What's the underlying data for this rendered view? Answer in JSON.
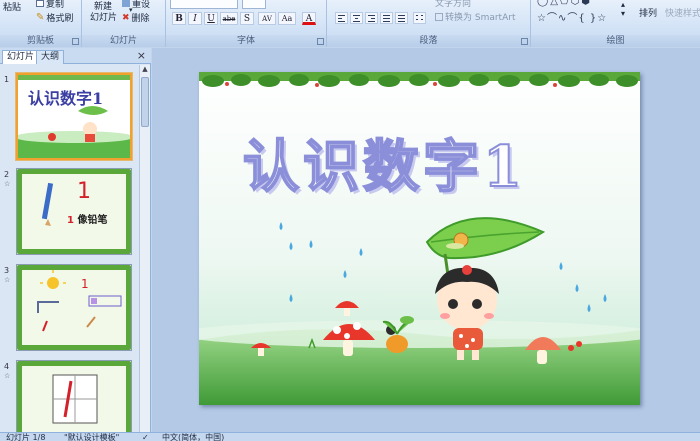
{
  "ribbon": {
    "clipboard": {
      "label": "剪贴板",
      "paste": "粘贴",
      "copy": "复制",
      "format_painter": "格式刷"
    },
    "slides": {
      "label": "幻灯片",
      "new_slide": "新建",
      "new_slide_2": "幻灯片",
      "reset": "重设",
      "delete": "删除"
    },
    "font": {
      "label": "字体",
      "bold": "B",
      "italic": "I",
      "underline": "U",
      "strike": "abe",
      "shadow": "S",
      "spacing": "AV",
      "case": "Aa",
      "color": "A"
    },
    "paragraph": {
      "label": "段落",
      "text_direction": "文字方向",
      "convert_smartart": "转换为 SmartArt"
    },
    "drawing": {
      "label": "绘图",
      "arrange": "排列",
      "quick_styles": "快速样式"
    }
  },
  "pane": {
    "tab_slides": "幻灯片",
    "tab_outline": "大纲",
    "close": "×",
    "thumbs": [
      {
        "num": "1",
        "title": "认识数字1"
      },
      {
        "num": "2",
        "digit": "1",
        "caption_num": "1",
        "caption": "像铅笔"
      },
      {
        "num": "3",
        "digit": "1"
      },
      {
        "num": "4"
      }
    ]
  },
  "slide": {
    "title": "认识数字1"
  },
  "status": {
    "slide_count": "幻灯片 1/8",
    "template": "\"默认设计模板\"",
    "language": "中文(简体，中国)"
  },
  "colors": {
    "ribbon_bg": "#d3e3f6",
    "accent_selected": "#f2a12e",
    "title_outline": "#8b8fd9",
    "grass": "#4fae3f"
  }
}
